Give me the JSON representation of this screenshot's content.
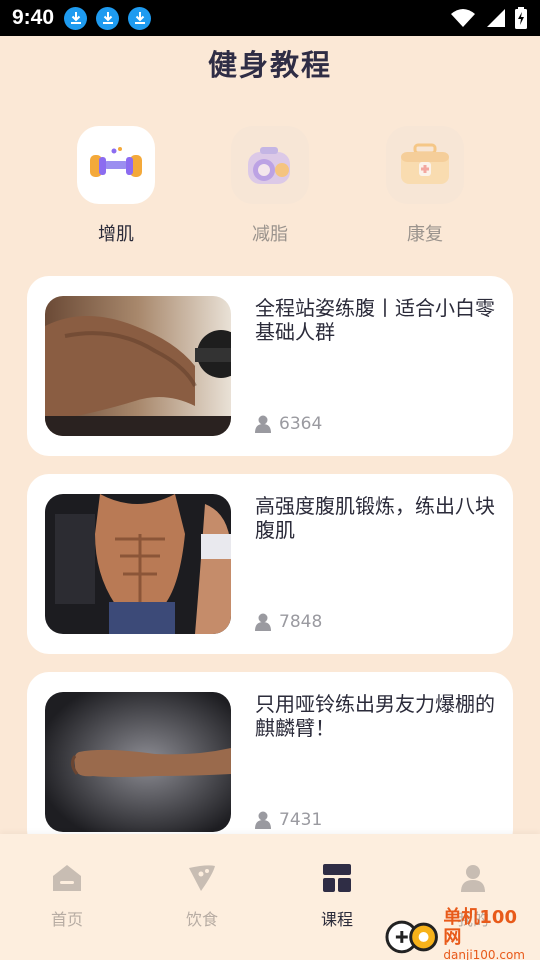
{
  "status_bar": {
    "time": "9:40",
    "icons": [
      "download-icon",
      "download-icon",
      "download-icon",
      "wifi-icon",
      "signal-icon",
      "battery-icon"
    ]
  },
  "page": {
    "title": "健身教程"
  },
  "categories": [
    {
      "label": "增肌",
      "icon": "dumbbell-icon",
      "active": true
    },
    {
      "label": "减脂",
      "icon": "scale-icon",
      "active": false
    },
    {
      "label": "康复",
      "icon": "first-aid-kit-icon",
      "active": false
    }
  ],
  "courses": [
    {
      "title": "全程站姿练腹丨适合小白零基础人群",
      "count": "6364",
      "image": "arm-curl-dumbbell-photo"
    },
    {
      "title": "高强度腹肌锻炼，练出八块腹肌",
      "count": "7848",
      "image": "abs-man-photo"
    },
    {
      "title": "只用哑铃练出男友力爆棚的麒麟臂！",
      "count": "7431",
      "image": "forearm-photo"
    }
  ],
  "bottom_nav": [
    {
      "label": "首页",
      "icon": "home-icon",
      "active": false
    },
    {
      "label": "饮食",
      "icon": "food-icon",
      "active": false
    },
    {
      "label": "课程",
      "icon": "course-grid-icon",
      "active": true
    },
    {
      "label": "我的",
      "icon": "user-icon",
      "active": false
    }
  ],
  "watermark": {
    "title": "单机100网",
    "url": "danji100.com"
  },
  "colors": {
    "background": "#fbe8d6",
    "accent": "#2f2d45",
    "muted": "#b7aca3"
  }
}
